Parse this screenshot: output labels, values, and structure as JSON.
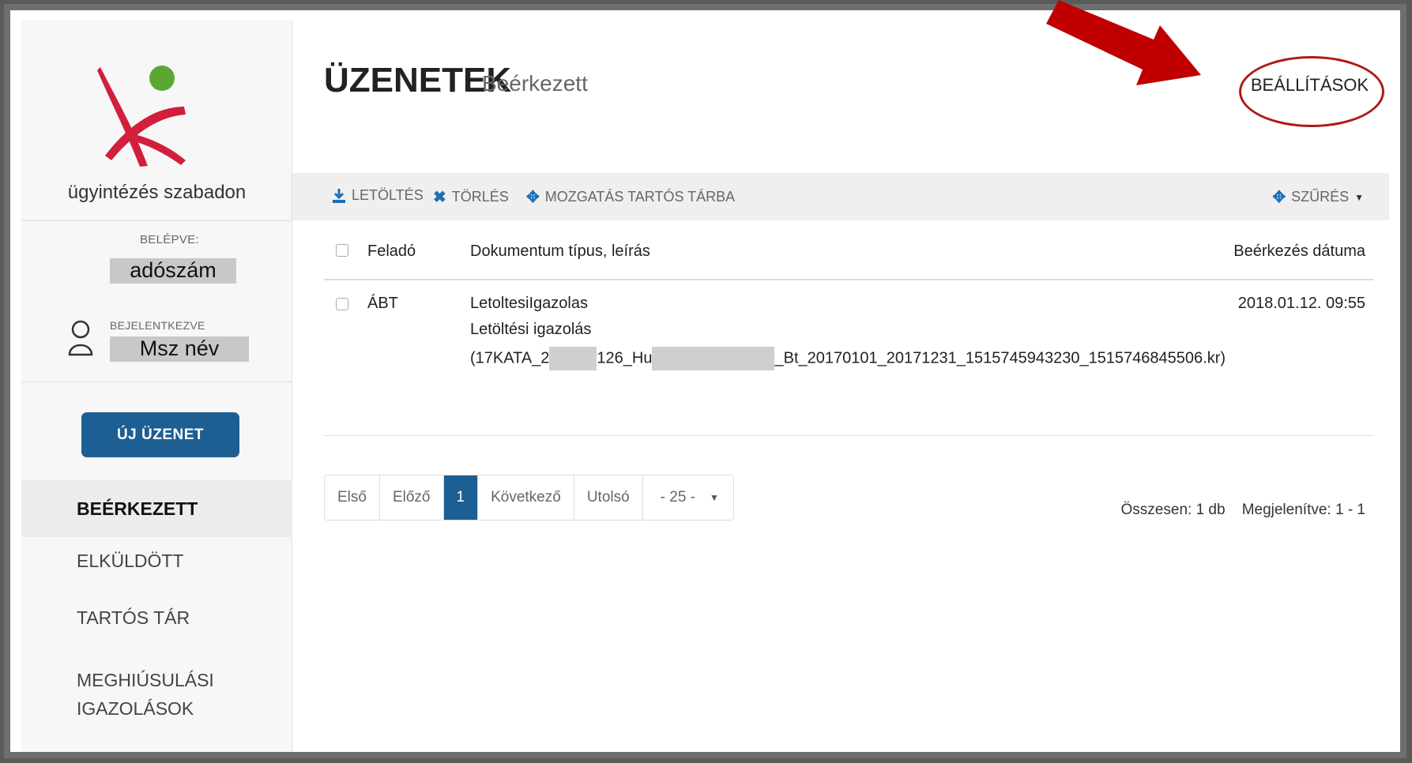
{
  "sidebar": {
    "tagline": "ügyintézés szabadon",
    "logged_in_label": "BELÉPVE:",
    "tax_id_value": "adószám",
    "signed_in_label": "BEJELENTKEZVE",
    "user_name_value": "Msz név",
    "new_message_label": "ÚJ ÜZENET",
    "nav": [
      {
        "label": "BEÉRKEZETT",
        "active": true
      },
      {
        "label": "ELKÜLDÖTT",
        "active": false
      },
      {
        "label": "TARTÓS TÁR",
        "active": false
      },
      {
        "label": "MEGHIÚSULÁSI",
        "active": false
      },
      {
        "label": "IGAZOLÁSOK",
        "active": false
      }
    ]
  },
  "header": {
    "title": "ÜZENETEK",
    "subtitle": "Beérkezett",
    "settings_label": "BEÁLLÍTÁSOK"
  },
  "toolbar": {
    "download_label": "LETÖLTÉS",
    "delete_label": "TÖRLÉS",
    "move_label": "MOZGATÁS TARTÓS TÁRBA",
    "filter_label": "SZŰRÉS"
  },
  "table": {
    "headers": {
      "sender": "Feladó",
      "doc": "Dokumentum típus, leírás",
      "date": "Beérkezés dátuma"
    },
    "rows": [
      {
        "sender": "ÁBT",
        "doc_type": "LetoltesiIgazolas",
        "doc_desc": "Letöltési igazolás",
        "file_part1": "(17KATA_2",
        "file_part2": "126_Hu",
        "file_part3": "_Bt_20170101_20171231_1515745943230_1515746845506.kr)",
        "date": "2018.01.12. 09:55"
      }
    ]
  },
  "pager": {
    "first": "Első",
    "prev": "Előző",
    "current": "1",
    "next": "Következő",
    "last": "Utolsó",
    "page_size": "- 25 -"
  },
  "summary": {
    "total": "Összesen: 1 db",
    "shown": "Megjelenítve: 1 - 1"
  },
  "colors": {
    "accent": "#1d5e93",
    "annotation_red": "#b01818"
  },
  "icons": [
    "download-icon",
    "close-icon",
    "move-icon",
    "filter-icon",
    "user-icon",
    "caret-down-icon"
  ]
}
